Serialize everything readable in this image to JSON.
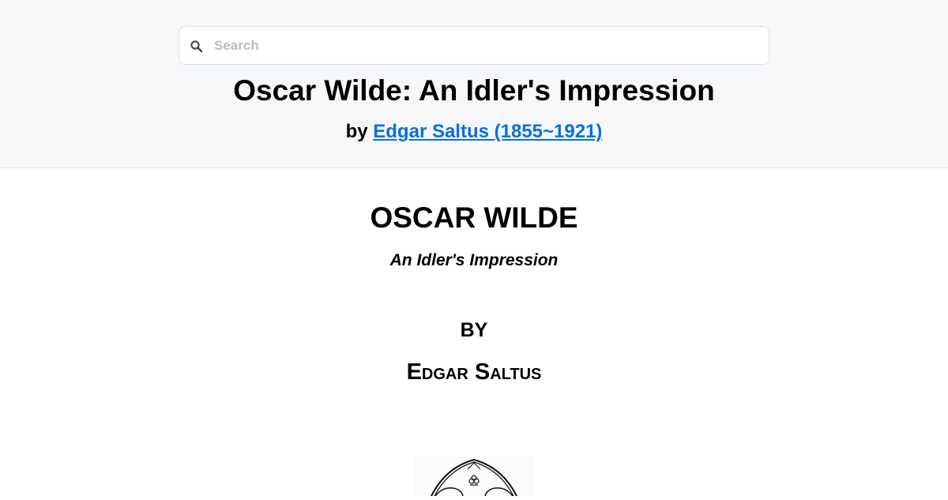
{
  "header": {
    "search": {
      "placeholder": "Search",
      "value": "",
      "icon": "search-icon"
    },
    "title": "Oscar Wilde: An Idler's Impression",
    "byline_prefix": "by",
    "author_link": "Edgar Saltus (1855~1921)"
  },
  "content": {
    "title": "OSCAR WILDE",
    "subtitle": "An Idler's Impression",
    "by": "BY",
    "author": "Edgar Saltus",
    "emblem_icon": "publisher-emblem-icon"
  },
  "colors": {
    "header_bg": "#f6f7f9",
    "link": "#0b6fe0",
    "text": "#000000"
  }
}
